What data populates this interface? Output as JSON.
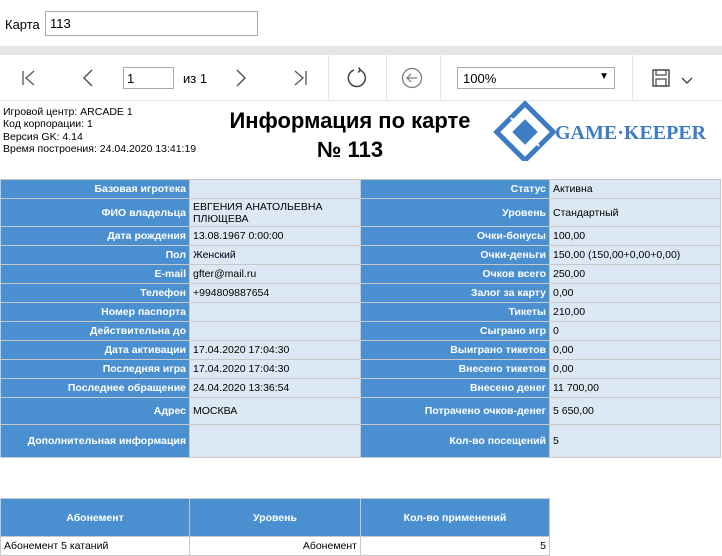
{
  "params": {
    "card_label": "Карта",
    "card_value": "113"
  },
  "toolbar": {
    "page_value": "1",
    "page_of": "из 1",
    "zoom": "100%"
  },
  "report": {
    "meta": [
      "Игровой центр: ARCADE 1",
      "Код корпорации: 1",
      "Версия GK: 4.14",
      "Время построения: 24.04.2020 13:41:19"
    ],
    "title_line1": "Информация по карте",
    "title_line2": "№ 113",
    "logo_text": "GAME·KEEPER"
  },
  "colors": {
    "header_blue": "#4a90d0",
    "value_bg": "#dce8f4",
    "logo_blue": "#3d7cc4"
  },
  "rows": [
    {
      "l1": "Базовая игротека",
      "v1": "",
      "l2": "Статус",
      "v2": "Активна"
    },
    {
      "l1": "ФИО владельца",
      "v1": "ЕВГЕНИЯ АНАТОЛЬЕВНА ПЛЮЩЕВА",
      "l2": "Уровень",
      "v2": "Стандартный"
    },
    {
      "l1": "Дата рождения",
      "v1": "13.08.1967 0:00:00",
      "l2": "Очки-бонусы",
      "v2": "100,00"
    },
    {
      "l1": "Пол",
      "v1": "Женский",
      "l2": "Очки-деньги",
      "v2": "150,00 (150,00+0,00+0,00)"
    },
    {
      "l1": "E-mail",
      "v1": "gfter@mail.ru",
      "l2": "Очков всего",
      "v2": "250,00"
    },
    {
      "l1": "Телефон",
      "v1": "+994809887654",
      "l2": "Залог за карту",
      "v2": "0,00"
    },
    {
      "l1": "Номер паспорта",
      "v1": "",
      "l2": "Тикеты",
      "v2": "210,00"
    },
    {
      "l1": "Действительна до",
      "v1": "",
      "l2": "Сыграно игр",
      "v2": "0"
    },
    {
      "l1": "Дата активации",
      "v1": "17.04.2020 17:04:30",
      "l2": "Выиграно тикетов",
      "v2": "0,00"
    },
    {
      "l1": "Последняя игра",
      "v1": "17.04.2020 17:04:30",
      "l2": "Внесено тикетов",
      "v2": "0,00"
    },
    {
      "l1": "Последнее обращение",
      "v1": "24.04.2020 13:36:54",
      "l2": "Внесено денег",
      "v2": "11 700,00"
    },
    {
      "l1": "Адрес",
      "v1": "МОСКВА",
      "l2": "Потрачено очков-денег",
      "v2": "5 650,00"
    },
    {
      "l1": "Дополнительная информация",
      "v1": "",
      "l2": "Кол-во посещений",
      "v2": "5"
    }
  ],
  "subscriptions": {
    "headers": [
      "Абонемент",
      "Уровень",
      "Кол-во применений"
    ],
    "rows": [
      [
        "Абонемент 5 катаний",
        "Абонемент",
        "5"
      ]
    ]
  }
}
